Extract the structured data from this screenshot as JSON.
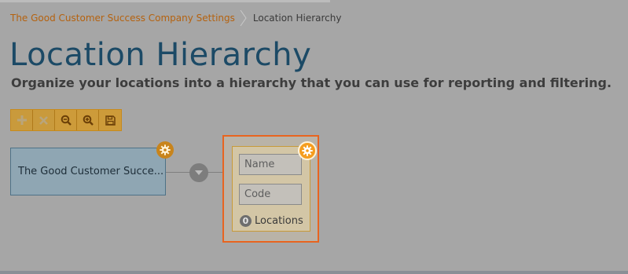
{
  "breadcrumb": {
    "parent": "The Good Customer Success Company Settings",
    "current": "Location Hierarchy"
  },
  "page": {
    "title": "Location Hierarchy",
    "subtitle": "Organize your locations into a hierarchy that you can use for reporting and filtering."
  },
  "toolbar": {
    "buttons": [
      {
        "icon": "plus-icon",
        "enabled": false
      },
      {
        "icon": "close-icon",
        "enabled": false
      },
      {
        "icon": "zoom-out-icon",
        "enabled": true
      },
      {
        "icon": "zoom-in-icon",
        "enabled": true
      },
      {
        "icon": "save-icon",
        "enabled": true
      }
    ]
  },
  "tree": {
    "root_label": "The Good Customer Succe...",
    "new_node": {
      "name_placeholder": "Name",
      "code_placeholder": "Code",
      "locations_count": "0",
      "locations_label": "Locations"
    }
  },
  "colors": {
    "title": "#1c4a66",
    "link": "#b5620f",
    "accent": "#e8641f",
    "gear": "#f59d1e"
  }
}
